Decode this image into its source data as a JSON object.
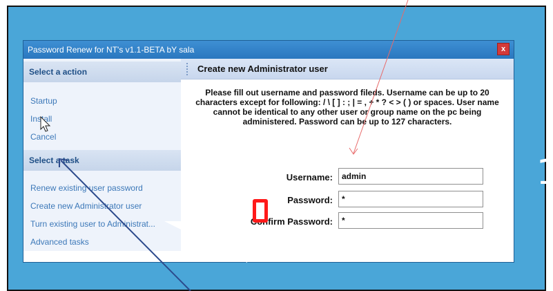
{
  "window": {
    "title": "Password Renew for NT's v1.1-BETA bY sala",
    "close_label": "x"
  },
  "sidebar": {
    "action_header": "Select a action",
    "actions": [
      "Startup",
      "Install",
      "Cancel"
    ],
    "task_header": "Select a task",
    "tasks": [
      "Renew existing user password",
      "Create new Administrator user",
      "Turn existing user to Administrat...",
      "Advanced tasks"
    ]
  },
  "panel": {
    "title": "Create new Administrator user",
    "instructions": "Please fill out username and password fileds. Username can be up to 20 characters except for following: / \\ [ ] : ; | = , + * ? < > ( ) or spaces. User name cannot be identical to any other user or group name on the pc being administered. Password can be up to 127 characters."
  },
  "form": {
    "username_label": "Username:",
    "username_value": "admin",
    "password_label": "Password:",
    "password_value": "*",
    "confirm_label": "Confirm Password:",
    "confirm_value": "*"
  },
  "slide_number": "1",
  "colors": {
    "background": "#4aa6d8",
    "titlebar": "#2a77bf",
    "link": "#3c78b8",
    "annotation_red": "#ff1a1a",
    "arrow_blue": "#2c4a8c"
  },
  "icons": {
    "close": "close-icon",
    "cursor": "cursor-icon"
  }
}
